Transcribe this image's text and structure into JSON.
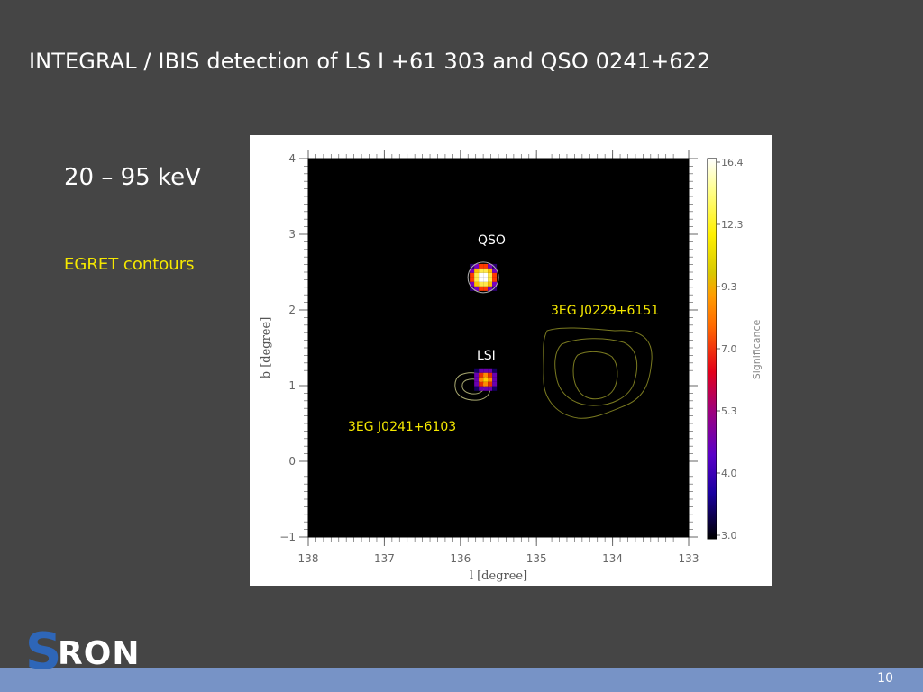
{
  "slide": {
    "title": "INTEGRAL / IBIS detection of LS I +61 303 and QSO 0241+622",
    "energy_range": "20 – 95 keV",
    "egret_label": "EGRET contours",
    "page_number": "10",
    "logo_letter": "S",
    "logo_text": "RON"
  },
  "colors": {
    "background": "#454545",
    "footer": "#7793c6",
    "egret_yellow": "#f5e800",
    "contour": "#7a7a20",
    "logo_blue": "#2e66b8"
  },
  "chart_data": {
    "type": "heatmap",
    "xlabel": "l [degree]",
    "ylabel": "b [degree]",
    "xlim": [
      138,
      133
    ],
    "ylim": [
      -1,
      4
    ],
    "x_ticks": [
      138,
      137,
      136,
      135,
      134,
      133
    ],
    "x_tick_labels": [
      "138",
      "137",
      "136",
      "135",
      "134",
      "133"
    ],
    "y_ticks": [
      -1,
      0,
      1,
      2,
      3,
      4
    ],
    "y_tick_labels": [
      "−1",
      "0",
      "1",
      "2",
      "3",
      "4"
    ],
    "colorbar": {
      "label": "Significance",
      "min": 3.0,
      "max": 16.4,
      "tick_values": [
        16.4,
        12.3,
        9.3,
        7.0,
        5.3,
        4.0,
        3.0
      ],
      "tick_labels": [
        "16.4",
        "12.3",
        "9.3",
        "7.0",
        "5.3",
        "4.0",
        "3.0"
      ]
    },
    "sources": [
      {
        "name": "QSO",
        "l": 135.7,
        "b": 2.43,
        "peak_significance": 16.4
      },
      {
        "name": "LSI",
        "l": 135.67,
        "b": 1.08,
        "peak_significance": 9.3
      }
    ],
    "egret_sources": [
      {
        "name": "3EG J0241+6103",
        "l": 135.9,
        "b": 1.0
      },
      {
        "name": "3EG J0229+6151",
        "l": 134.0,
        "b": 1.15
      }
    ]
  }
}
